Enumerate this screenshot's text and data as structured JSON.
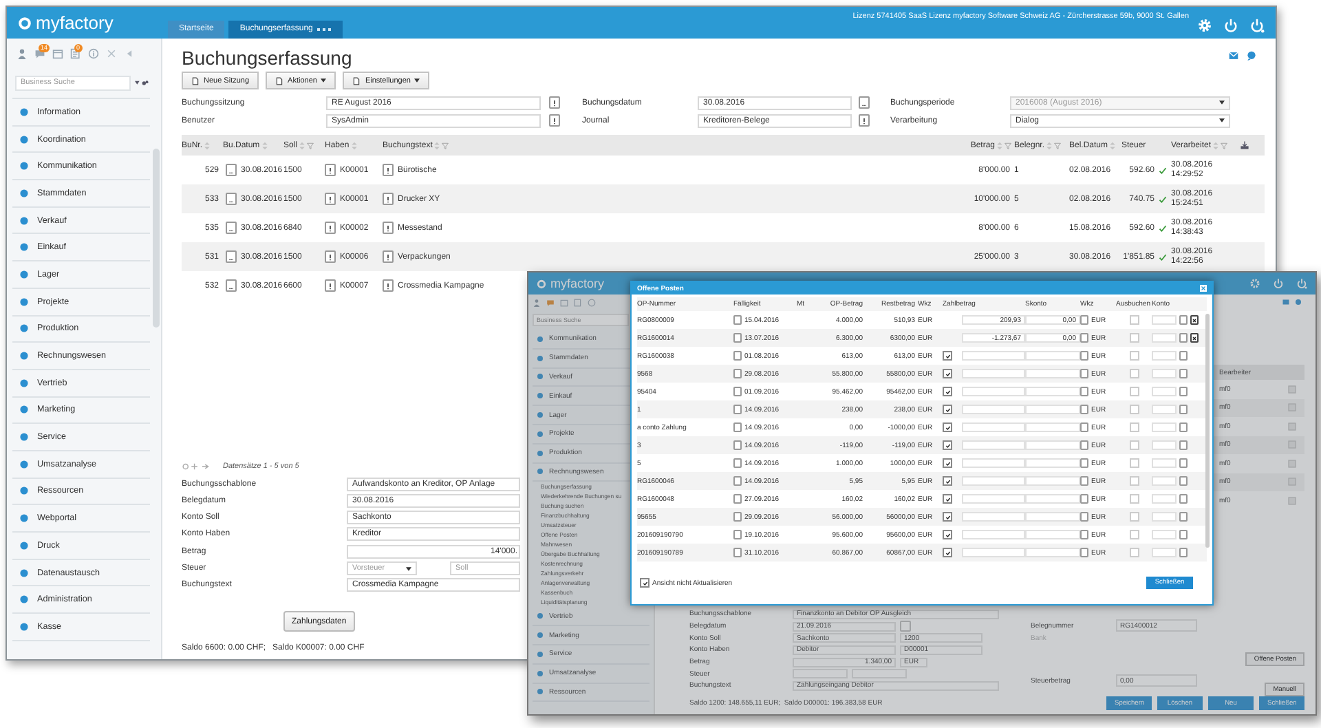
{
  "back": {
    "logo": "myfactory",
    "tabs": [
      {
        "label": "Startseite",
        "selected": false
      },
      {
        "label": "Buchungserfassung",
        "selected": true
      }
    ],
    "license": "Lizenz 5741405 SaaS Lizenz myfactory Software Schweiz AG - Zürcherstrasse 59b, 9000 St. Gallen",
    "badges": [
      "14",
      "0"
    ],
    "search": {
      "placeholder": "Business Suche"
    },
    "menu": [
      "Information",
      "Koordination",
      "Kommunikation",
      "Stammdaten",
      "Verkauf",
      "Einkauf",
      "Lager",
      "Projekte",
      "Produktion",
      "Rechnungswesen",
      "Vertrieb",
      "Marketing",
      "Service",
      "Umsatzanalyse",
      "Ressourcen",
      "Webportal",
      "Druck",
      "Datenaustausch",
      "Administration",
      "Kasse"
    ],
    "title": "Buchungserfassung",
    "actions": [
      {
        "label": "Neue Sitzung",
        "dropdown": false
      },
      {
        "label": "Aktionen",
        "dropdown": true
      },
      {
        "label": "Einstellungen",
        "dropdown": true
      }
    ],
    "fields": [
      {
        "label": "Buchungssitzung",
        "value": "RE August 2016",
        "kind": "lookup",
        "disabled": false
      },
      {
        "label": "Buchungsdatum",
        "value": "30.08.2016",
        "kind": "date",
        "disabled": false
      },
      {
        "label": "Buchungsperiode",
        "value": "2016008 (August 2016)",
        "kind": "select",
        "disabled": true
      },
      {
        "label": "Benutzer",
        "value": "SysAdmin",
        "kind": "lookup",
        "disabled": false
      },
      {
        "label": "Journal",
        "value": "Kreditoren-Belege",
        "kind": "lookup",
        "disabled": false
      },
      {
        "label": "Verarbeitung",
        "value": "Dialog",
        "kind": "select",
        "disabled": false
      }
    ],
    "columns": [
      {
        "label": "BuNr.",
        "sortable": true,
        "filterable": false
      },
      {
        "label": "Bu.Datum",
        "sortable": true,
        "filterable": false
      },
      {
        "label": "Soll",
        "sortable": true,
        "filterable": true
      },
      {
        "label": "Haben",
        "sortable": true,
        "filterable": false
      },
      {
        "label": "Buchungstext",
        "sortable": true,
        "filterable": true
      },
      {
        "label": "Betrag",
        "sortable": true,
        "filterable": true
      },
      {
        "label": "Belegnr.",
        "sortable": true,
        "filterable": true
      },
      {
        "label": "Bel.Datum",
        "sortable": true,
        "filterable": false
      },
      {
        "label": "Steuer",
        "sortable": false,
        "filterable": false
      },
      {
        "label": "Verarbeitet",
        "sortable": true,
        "filterable": true
      }
    ],
    "rows": [
      {
        "nr": "529",
        "datum": "30.08.2016",
        "soll": "1500",
        "haben": "K00001",
        "text": "Bürotische",
        "betrag": "8'000.00",
        "beleg": "1",
        "beldatum": "02.08.2016",
        "steuer": "592.60",
        "verarbeitet": "30.08.2016 14:29:52"
      },
      {
        "nr": "533",
        "datum": "30.08.2016",
        "soll": "1500",
        "haben": "K00001",
        "text": "Drucker XY",
        "betrag": "10'000.00",
        "beleg": "5",
        "beldatum": "02.08.2016",
        "steuer": "740.75",
        "verarbeitet": "30.08.2016 15:24:51"
      },
      {
        "nr": "535",
        "datum": "30.08.2016",
        "soll": "6840",
        "haben": "K00002",
        "text": "Messestand",
        "betrag": "8'000.00",
        "beleg": "6",
        "beldatum": "15.08.2016",
        "steuer": "592.60",
        "verarbeitet": "30.08.2016 14:38:43"
      },
      {
        "nr": "531",
        "datum": "30.08.2016",
        "soll": "1500",
        "haben": "K00006",
        "text": "Verpackungen",
        "betrag": "25'000.00",
        "beleg": "3",
        "beldatum": "30.08.2016",
        "steuer": "1'851.85",
        "verarbeitet": "30.08.2016 14:22:56"
      },
      {
        "nr": "532",
        "datum": "30.08.2016",
        "soll": "6600",
        "haben": "K00007",
        "text": "Crossmedia Kampagne"
      }
    ],
    "pager": "Datensätze 1 - 5 von 5",
    "detail": [
      {
        "label": "Buchungsschablone",
        "value": "Aufwandskonto an Kreditor, OP Anlage",
        "kind": "text"
      },
      {
        "label": "Belegdatum",
        "value": "30.08.2016",
        "kind": "text"
      },
      {
        "label": "Konto Soll",
        "value": "Sachkonto",
        "kind": "text"
      },
      {
        "label": "Konto Haben",
        "value": "Kreditor",
        "kind": "text"
      },
      {
        "label": "Betrag",
        "value": "14'000.",
        "kind": "amount"
      },
      {
        "label": "Steuer",
        "value": "Vorsteuer",
        "value2": "Soll",
        "kind": "selects"
      },
      {
        "label": "Buchungstext",
        "value": "Crossmedia Kampagne",
        "kind": "text"
      }
    ],
    "payment_button": "Zahlungsdaten",
    "saldo": "Saldo 6600: 0.00 CHF;   Saldo K00007: 0.00 CHF"
  },
  "front": {
    "logo": "myfactory",
    "search": {
      "placeholder": "Business Suche"
    },
    "menu": [
      {
        "label": "Kommunikation"
      },
      {
        "label": "Stammdaten"
      },
      {
        "label": "Verkauf"
      },
      {
        "label": "Einkauf"
      },
      {
        "label": "Lager"
      },
      {
        "label": "Projekte"
      },
      {
        "label": "Produktion"
      },
      {
        "label": "Rechnungswesen",
        "children": [
          "Buchungserfassung",
          "Wiederkehrende Buchungen su",
          "Buchung suchen",
          "Finanzbuchhaltung",
          "Umsatzsteuer",
          "Offene Posten",
          "Mahnwesen",
          "Übergabe Buchhaltung",
          "Kostenrechnung",
          "Zahlungsverkehr",
          "Anlagenverwaltung",
          "Kassenbuch",
          "Liquiditätsplanung"
        ]
      },
      {
        "label": "Vertrieb"
      },
      {
        "label": "Marketing"
      },
      {
        "label": "Service"
      },
      {
        "label": "Umsatzanalyse"
      },
      {
        "label": "Ressourcen"
      }
    ],
    "grid_header": "Bearbeiter",
    "grid_rows": [
      "mf0",
      "mf0",
      "mf0",
      "mf0",
      "mf0",
      "mf0",
      "mf0"
    ],
    "dialog": {
      "title": "Offene Posten",
      "columns": [
        "OP-Nummer",
        "Fälligkeit",
        "Mt",
        "OP-Betrag",
        "Restbetrag",
        "Wkz",
        "Zahlbetrag",
        "Skonto",
        "Wkz",
        "Ausbuchen",
        "Konto"
      ],
      "rows": [
        {
          "ausbuchen": false,
          "nummer": "RG0800009",
          "faellig": "15.04.2016",
          "betrag": "4.000,00",
          "rest": "510,93",
          "wkz": "EUR",
          "zahl": "209,93",
          "zahl_checked": false,
          "skonto": "0,00",
          "wkz2": "EUR",
          "remove": true
        },
        {
          "ausbuchen": false,
          "nummer": "RG1600014",
          "faellig": "13.07.2016",
          "betrag": "6.300,00",
          "rest": "6300,00",
          "wkz": "EUR",
          "zahl": "-1.273,67",
          "zahl_checked": false,
          "skonto": "0,00",
          "wkz2": "EUR",
          "remove": true
        },
        {
          "ausbuchen": false,
          "nummer": "RG1600038",
          "faellig": "01.08.2016",
          "betrag": "613,00",
          "rest": "613,00",
          "wkz": "EUR",
          "zahl_checked": true,
          "wkz2": "EUR",
          "remove": false
        },
        {
          "ausbuchen": false,
          "nummer": "9568",
          "faellig": "29.08.2016",
          "betrag": "55.800,00",
          "rest": "55800,00",
          "wkz": "EUR",
          "zahl_checked": true,
          "wkz2": "EUR",
          "remove": false
        },
        {
          "ausbuchen": false,
          "nummer": "95404",
          "faellig": "01.09.2016",
          "betrag": "95.462,00",
          "rest": "95462,00",
          "wkz": "EUR",
          "zahl_checked": true,
          "wkz2": "EUR",
          "remove": false
        },
        {
          "ausbuchen": false,
          "nummer": "1",
          "faellig": "14.09.2016",
          "betrag": "238,00",
          "rest": "238,00",
          "wkz": "EUR",
          "zahl_checked": true,
          "wkz2": "EUR",
          "remove": false
        },
        {
          "ausbuchen": false,
          "nummer": "a conto Zahlung",
          "faellig": "14.09.2016",
          "betrag": "0,00",
          "rest": "-1000,00",
          "wkz": "EUR",
          "zahl_checked": true,
          "wkz2": "EUR",
          "remove": false
        },
        {
          "ausbuchen": false,
          "nummer": "3",
          "faellig": "14.09.2016",
          "betrag": "-119,00",
          "rest": "-119,00",
          "wkz": "EUR",
          "zahl_checked": true,
          "wkz2": "EUR",
          "remove": false
        },
        {
          "ausbuchen": false,
          "nummer": "5",
          "faellig": "14.09.2016",
          "betrag": "1.000,00",
          "rest": "1000,00",
          "wkz": "EUR",
          "zahl_checked": true,
          "wkz2": "EUR",
          "remove": false
        },
        {
          "ausbuchen": false,
          "nummer": "RG1600046",
          "faellig": "14.09.2016",
          "betrag": "5,95",
          "rest": "5,95",
          "wkz": "EUR",
          "zahl_checked": true,
          "wkz2": "EUR",
          "remove": false
        },
        {
          "ausbuchen": false,
          "nummer": "RG1600048",
          "faellig": "27.09.2016",
          "betrag": "160,02",
          "rest": "160,02",
          "wkz": "EUR",
          "zahl_checked": true,
          "wkz2": "EUR",
          "remove": false
        },
        {
          "ausbuchen": false,
          "nummer": "95655",
          "faellig": "29.09.2016",
          "betrag": "56.000,00",
          "rest": "56000,00",
          "wkz": "EUR",
          "zahl_checked": true,
          "wkz2": "EUR",
          "remove": false
        },
        {
          "ausbuchen": false,
          "nummer": "201609190790",
          "faellig": "19.10.2016",
          "betrag": "95.600,00",
          "rest": "95600,00",
          "wkz": "EUR",
          "zahl_checked": true,
          "wkz2": "EUR",
          "remove": false
        },
        {
          "ausbuchen": false,
          "nummer": "201609190789",
          "faellig": "31.10.2016",
          "betrag": "60.867,00",
          "rest": "60867,00",
          "wkz": "EUR",
          "zahl_checked": true,
          "wkz2": "EUR",
          "remove": false
        }
      ],
      "no_refresh": {
        "label": "Ansicht nicht Aktualisieren",
        "checked": true
      },
      "close_button": "Schließen"
    },
    "form": [
      {
        "label": "Buchungsschablone",
        "kind": "wide",
        "value": "Finanzkonto an Debitor OP Ausgleich"
      },
      {
        "label": "Belegdatum",
        "kind": "date",
        "value": "21.09.2016"
      },
      {
        "label": "Konto Soll",
        "kind": "account",
        "value": "Sachkonto",
        "account": "1200"
      },
      {
        "label": "Konto Haben",
        "kind": "account",
        "value": "Debitor",
        "account": "D00001"
      },
      {
        "label": "Betrag",
        "kind": "amount",
        "value": "1.340,00",
        "currency": "EUR"
      },
      {
        "label": "Steuer",
        "kind": "tax"
      },
      {
        "label": "Buchungstext",
        "kind": "wide",
        "value": "Zahlungseingang Debitor"
      }
    ],
    "side": [
      {
        "label": "Belegnummer",
        "value": "RG1400012",
        "disabled": false
      },
      {
        "label": "Bank",
        "disabled": true
      },
      {
        "label": "Steuerbetrag",
        "value": "0,00",
        "disabled": false
      }
    ],
    "side_buttons": [
      "Offene Posten",
      "Manuell"
    ],
    "saldo": "Saldo 1200: 148.655,11 EUR;  Saldo D00001: 196.383,58 EUR",
    "buttons": [
      "Speichern",
      "Löschen",
      "Neu",
      "Schließen"
    ]
  }
}
